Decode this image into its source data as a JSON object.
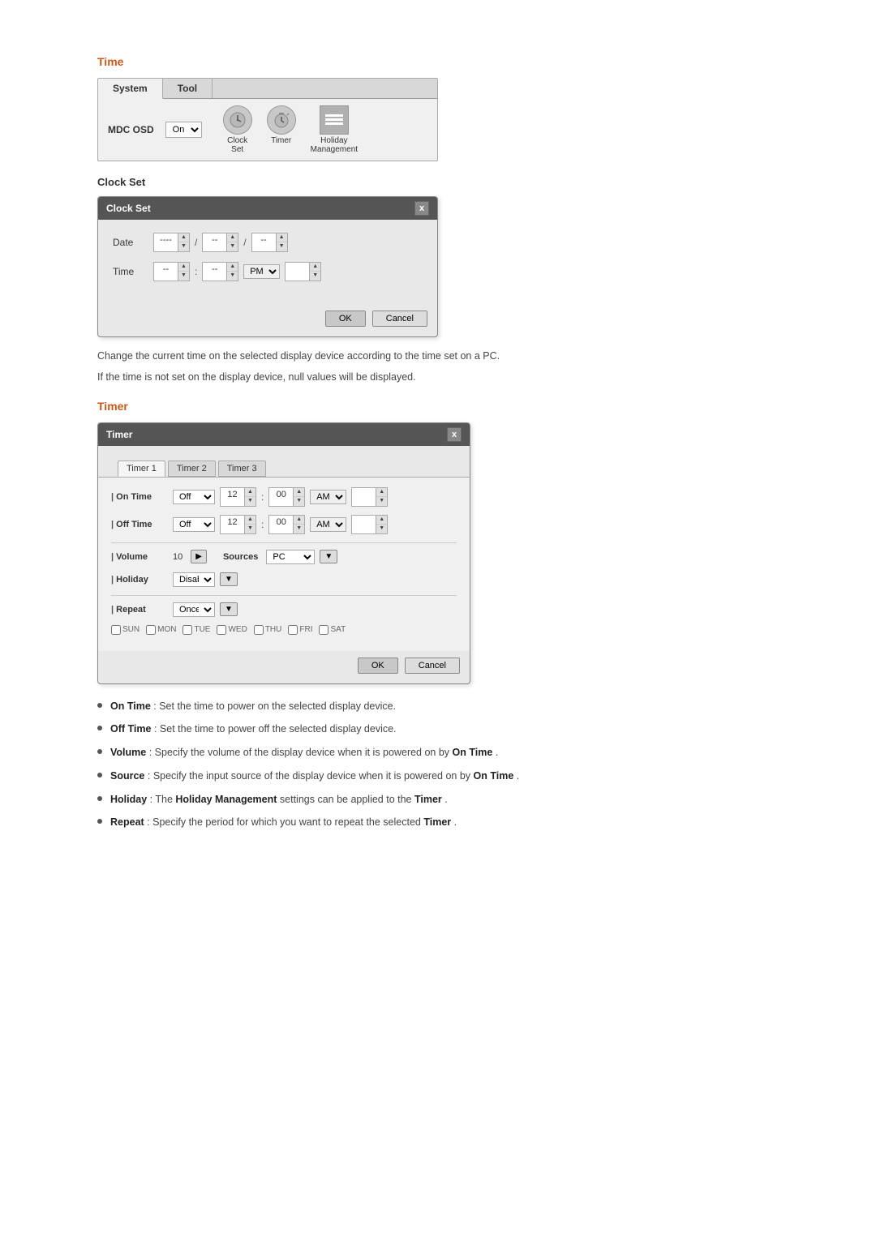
{
  "page": {
    "time_section_title": "Time",
    "toolbar": {
      "tabs": [
        {
          "label": "System",
          "active": false
        },
        {
          "label": "Tool",
          "active": true
        }
      ],
      "mdc_osd_label": "MDC OSD",
      "mdc_osd_value": "On",
      "icons": [
        {
          "name": "clock-icon",
          "label_line1": "Clock",
          "label_line2": "Set"
        },
        {
          "name": "timer-icon",
          "label_line1": "Timer",
          "label_line2": ""
        },
        {
          "name": "holiday-icon",
          "label_line1": "Holiday",
          "label_line2": "Management"
        }
      ]
    },
    "clock_set_label": "Clock Set",
    "clock_dialog": {
      "title": "Clock Set",
      "close_label": "x",
      "date_label": "Date",
      "date_val1": "----",
      "date_sep1": "/",
      "date_val2": "--",
      "date_sep2": "/",
      "date_val3": "--",
      "time_label": "Time",
      "time_val1": "--",
      "time_sep": ":",
      "time_val2": "--",
      "time_ampm": "PM",
      "ok_label": "OK",
      "cancel_label": "Cancel"
    },
    "clock_desc1": "Change the current time on the selected display device according to the time set on a PC.",
    "clock_desc2": "If the time is not set on the display device, null values will be displayed.",
    "timer_section_title": "Timer",
    "timer_dialog": {
      "title": "Timer",
      "close_label": "x",
      "tabs": [
        {
          "label": "Timer 1",
          "active": true
        },
        {
          "label": "Timer 2",
          "active": false
        },
        {
          "label": "Timer 3",
          "active": false
        }
      ],
      "on_time_label": "On Time",
      "on_time_select": "Off",
      "on_time_hour": "12",
      "on_time_min": "00",
      "on_time_ampm": "AM",
      "off_time_label": "Off Time",
      "off_time_select": "Off",
      "off_time_hour": "12",
      "off_time_min": "00",
      "off_time_ampm": "AM",
      "volume_label": "Volume",
      "volume_value": "10",
      "sources_label": "Sources",
      "sources_value": "PC",
      "holiday_label": "Holiday",
      "holiday_select": "Disable",
      "repeat_label": "Repeat",
      "repeat_select": "Once",
      "days": [
        "SUN",
        "MON",
        "TUE",
        "WED",
        "THU",
        "FRI",
        "SAT"
      ],
      "ok_label": "OK",
      "cancel_label": "Cancel"
    },
    "bullets": [
      {
        "label": "On Time",
        "colon": ": ",
        "text": "Set the time to power on the selected display device."
      },
      {
        "label": "Off Time",
        "colon": ": ",
        "text": "Set the time to power off the selected display device."
      },
      {
        "label": "Volume",
        "colon": ": ",
        "text_pre": "Specify the volume of the display device when it is powered on by ",
        "text_bold": "On Time",
        "text_post": "."
      },
      {
        "label": "Source",
        "colon": ": ",
        "text_pre": "Specify the input source of the display device when it is powered on by ",
        "text_bold": "On Time",
        "text_post": "."
      },
      {
        "label": "Holiday",
        "colon": ": The ",
        "text_bold": "Holiday Management",
        "text_post": " settings can be applied to the ",
        "text_bold2": "Timer",
        "text_post2": "."
      },
      {
        "label": "Repeat",
        "colon": " : Specify the period for which you want to repeat the selected ",
        "text_bold": "Timer",
        "text_post": "."
      }
    ]
  }
}
